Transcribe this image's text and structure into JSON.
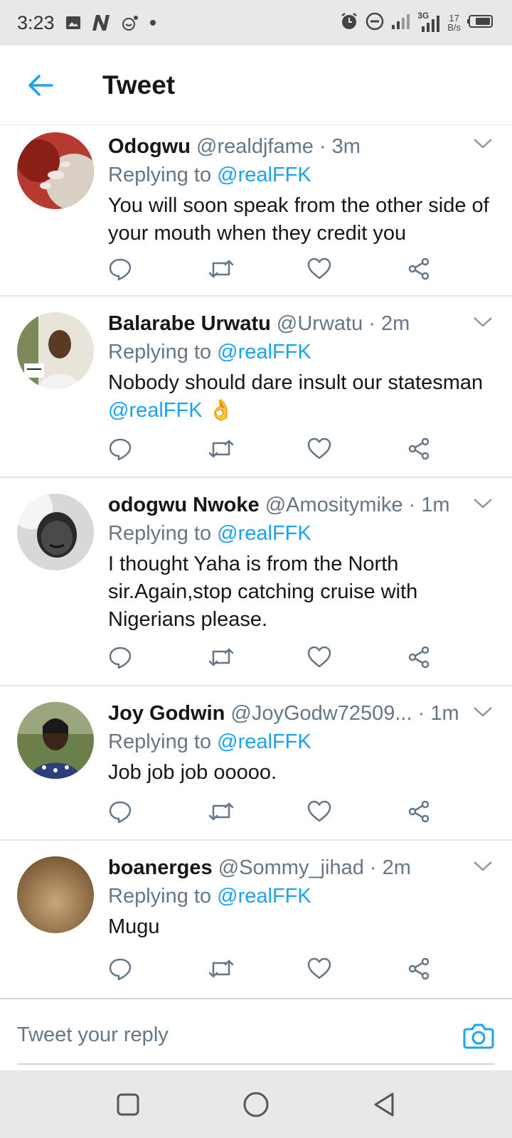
{
  "status_bar": {
    "time": "3:23",
    "net_speed_value": "17",
    "net_speed_unit": "B/s",
    "network_label": "3G",
    "icons": [
      "image-icon",
      "n-app-icon",
      "notification-app-icon",
      "dot-icon",
      "alarm-icon",
      "dnd-icon",
      "signal-icon",
      "signal-3g-icon",
      "battery-icon"
    ]
  },
  "header": {
    "title": "Tweet"
  },
  "reply_prefix": "Replying to ",
  "tweets": [
    {
      "name": "Odogwu",
      "handle": "@realdjfame",
      "time": "· 3m",
      "reply_to": "@realFFK",
      "text": "You will soon speak from the other side of your mouth when they credit you",
      "mention": ""
    },
    {
      "name": "Balarabe Urwatu",
      "handle": "@Urwatu",
      "time": "· 2m",
      "reply_to": "@realFFK",
      "text": "Nobody should dare insult our statesman ",
      "mention": "@realFFK",
      "emoji": "👌"
    },
    {
      "name": "odogwu Nwoke",
      "handle": "@Amositymike",
      "time": "· 1m",
      "reply_to": "@realFFK",
      "text": "I thought Yaha is from the North sir.Again,stop catching cruise with Nigerians please.",
      "mention": ""
    },
    {
      "name": "Joy Godwin",
      "handle": "@JoyGodw72509...",
      "time": "· 1m",
      "reply_to": "@realFFK",
      "text": "Job job job ooooo.",
      "mention": ""
    },
    {
      "name": "boanerges",
      "handle": "@Sommy_jihad",
      "time": "· 2m",
      "reply_to": "@realFFK",
      "text": "Mugu",
      "mention": ""
    }
  ],
  "reply_bar": {
    "placeholder": "Tweet your reply"
  },
  "colors": {
    "accent": "#1da1f2",
    "secondary_text": "#657786",
    "primary_text": "#14171a",
    "divider": "#e1e8ed"
  }
}
